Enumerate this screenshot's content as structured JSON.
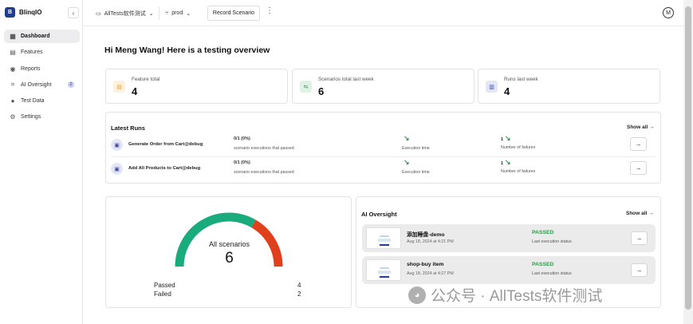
{
  "brand": {
    "name": "BlinqIO",
    "logo_text": "B"
  },
  "sidebar": {
    "collapse_glyph": "‹",
    "items": [
      {
        "label": "Dashboard",
        "icon": "grid-icon",
        "glyph": "▦",
        "active": true
      },
      {
        "label": "Features",
        "icon": "document-icon",
        "glyph": "▤"
      },
      {
        "label": "Reports",
        "icon": "play-circle-icon",
        "glyph": "◉"
      },
      {
        "label": "AI Oversight",
        "icon": "scan-icon",
        "glyph": "⌗",
        "badge": "2"
      },
      {
        "label": "Test Data",
        "icon": "location-pin-icon",
        "glyph": "●"
      },
      {
        "label": "Settings",
        "icon": "gear-icon",
        "glyph": "⚙"
      }
    ]
  },
  "topbar": {
    "project": "AllTests软件测试",
    "environment": "prod",
    "record_button": "Record Scenario",
    "kebab": "⋮",
    "avatar": "M",
    "folder_glyph": "▭",
    "branch_glyph": "⑂",
    "chevron": "⌄"
  },
  "greeting": "Hi Meng Wang! Here is a testing overview",
  "stats": [
    {
      "label": "Feature total",
      "value": "4",
      "icon": "file-icon",
      "glyph": "▤",
      "color": "#f0a020",
      "bg": "#fdf0dc"
    },
    {
      "label": "Scenarios total last week",
      "value": "6",
      "icon": "steps-icon",
      "glyph": "⇆",
      "color": "#2f9a4f",
      "bg": "#dff2e6"
    },
    {
      "label": "Runs last week",
      "value": "4",
      "icon": "runs-icon",
      "glyph": "▥",
      "color": "#3b46a8",
      "bg": "#e3e6f6"
    }
  ],
  "latest_runs": {
    "title": "Latest Runs",
    "show_all": "Show all →",
    "rows": [
      {
        "name": "Generate Order from Cart@debug",
        "ratio": "0/1 (0%)",
        "sub": "scenario executions that passed",
        "time_trend": "↘",
        "time_label": "Execution time",
        "fail_count": "1",
        "fail_trend": "↘",
        "fail_label": "Number of failures",
        "arrow": "→"
      },
      {
        "name": "Add All Products to Cart@debug",
        "ratio": "0/1 (0%)",
        "sub": "scenario executions that passed",
        "time_trend": "↘",
        "time_label": "Execution time",
        "fail_count": "1",
        "fail_trend": "↘",
        "fail_label": "Number of failures",
        "arrow": "→"
      }
    ]
  },
  "scenarios_gauge": {
    "label": "All scenarios",
    "total": "6",
    "passed_label": "Passed",
    "passed": 4,
    "failed_label": "Failed",
    "failed": 2,
    "passed_color": "#1aab7c",
    "failed_color": "#e0401c"
  },
  "ai_oversight": {
    "title": "AI Oversight",
    "show_all": "Show all →",
    "items": [
      {
        "name": "添加睡盘-demo",
        "date": "Aug 18, 2024 at 4:21 PM",
        "status": "PASSED",
        "status_label": "Last execution status",
        "arrow": "→"
      },
      {
        "name": "shop-buy item",
        "date": "Aug 18, 2024 at 4:27 PM",
        "status": "PASSED",
        "status_label": "Last execution status",
        "arrow": "→"
      }
    ]
  },
  "watermark": {
    "text": "公众号 · AllTests软件测试",
    "icon": "wechat-icon"
  }
}
